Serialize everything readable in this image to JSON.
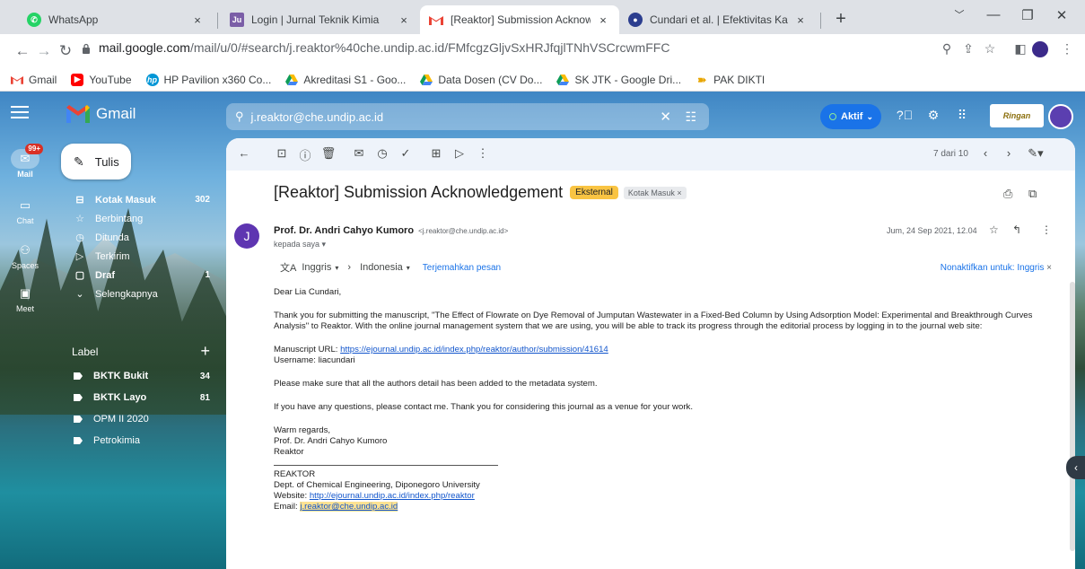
{
  "browser": {
    "tabs": [
      {
        "title": "WhatsApp",
        "close": "×"
      },
      {
        "title": "Login | Jurnal Teknik Kimia",
        "close": "×"
      },
      {
        "title": "[Reaktor] Submission Acknowled",
        "close": "×"
      },
      {
        "title": "Cundari et al. | Efektivitas Karbon",
        "close": "×"
      }
    ],
    "new_tab": "+",
    "url_host": "mail.google.com",
    "url_path": "/mail/u/0/#search/j.reaktor%40che.undip.ac.id/FMfcgzGljvSxHRJfqjlTNhVSCrcwmFFC",
    "bookmarks": [
      {
        "label": "Gmail"
      },
      {
        "label": "YouTube"
      },
      {
        "label": "HP Pavilion x360 Co..."
      },
      {
        "label": "Akreditasi S1 - Goo..."
      },
      {
        "label": "Data Dosen (CV Do..."
      },
      {
        "label": "SK JTK - Google Dri..."
      },
      {
        "label": "PAK DIKTI"
      }
    ]
  },
  "gmail": {
    "logo": "Gmail",
    "rail": {
      "mail_badge": "99+",
      "mail": "Mail",
      "chat": "Chat",
      "spaces": "Spaces",
      "meet": "Meet"
    },
    "compose": "Tulis",
    "nav": [
      {
        "label": "Kotak Masuk",
        "count": "302"
      },
      {
        "label": "Berbintang",
        "count": ""
      },
      {
        "label": "Ditunda",
        "count": ""
      },
      {
        "label": "Terkirim",
        "count": ""
      },
      {
        "label": "Draf",
        "count": "1"
      },
      {
        "label": "Selengkapnya",
        "count": ""
      }
    ],
    "label_header": "Label",
    "labels": [
      {
        "label": "BKTK Bukit",
        "count": "34"
      },
      {
        "label": "BKTK Layo",
        "count": "81"
      },
      {
        "label": "OPM II 2020",
        "count": ""
      },
      {
        "label": "Petrokimia",
        "count": ""
      }
    ],
    "search_value": "j.reaktor@che.undip.ac.id",
    "status": "Aktif",
    "brand_text": "Ringan",
    "pager": "7 dari 10"
  },
  "message": {
    "subject": "[Reaktor] Submission Acknowledgement",
    "chip_external": "Eksternal",
    "chip_inbox": "Kotak Masuk ×",
    "sender_name": "Prof. Dr. Andri Cahyo Kumoro",
    "sender_email": "<j.reaktor@che.undip.ac.id>",
    "to_me": "kepada saya ▾",
    "date": "Jum, 24 Sep 2021, 12.04",
    "translate_from": "Inggris",
    "translate_to": "Indonesia",
    "translate_link": "Terjemahkan pesan",
    "translate_off": "Nonaktifkan untuk: Inggris",
    "greeting": "Dear Lia Cundari,",
    "para1": "Thank you for submitting the manuscript, \"The Effect of Flowrate on Dye Removal of Jumputan Wastewater in a Fixed-Bed Column by Using Adsorption Model: Experimental and Breakthrough Curves Analysis\" to Reaktor. With the online journal management system that we are using, you will be able to track its progress through the editorial process by logging in to the journal web site:",
    "manuscript_label": "Manuscript URL: ",
    "manuscript_url": "https://ejournal.undip.ac.id/index.php/reaktor/author/submission/41614",
    "username_line": "Username: liacundari",
    "para2": "Please make sure that all the authors detail has been added to the metadata system.",
    "para3": "If you have any questions, please contact me. Thank you for considering this journal as a venue for your work.",
    "closing": "Warm regards,",
    "sign_name": "Prof. Dr. Andri Cahyo Kumoro",
    "sign_journal": "Reaktor",
    "org_name": "REAKTOR",
    "org_dept": "Dept. of Chemical Engineering, Diponegoro University",
    "website_label": "Website: ",
    "website_url": "http://ejournal.undip.ac.id/index.php/reaktor",
    "email_label": "Email: ",
    "email_value": "j.reaktor@che.undip.ac.id"
  },
  "colors": {
    "accent": "#1a73e8",
    "external_chip": "#f9c443",
    "avatar": "#5e35b1"
  }
}
